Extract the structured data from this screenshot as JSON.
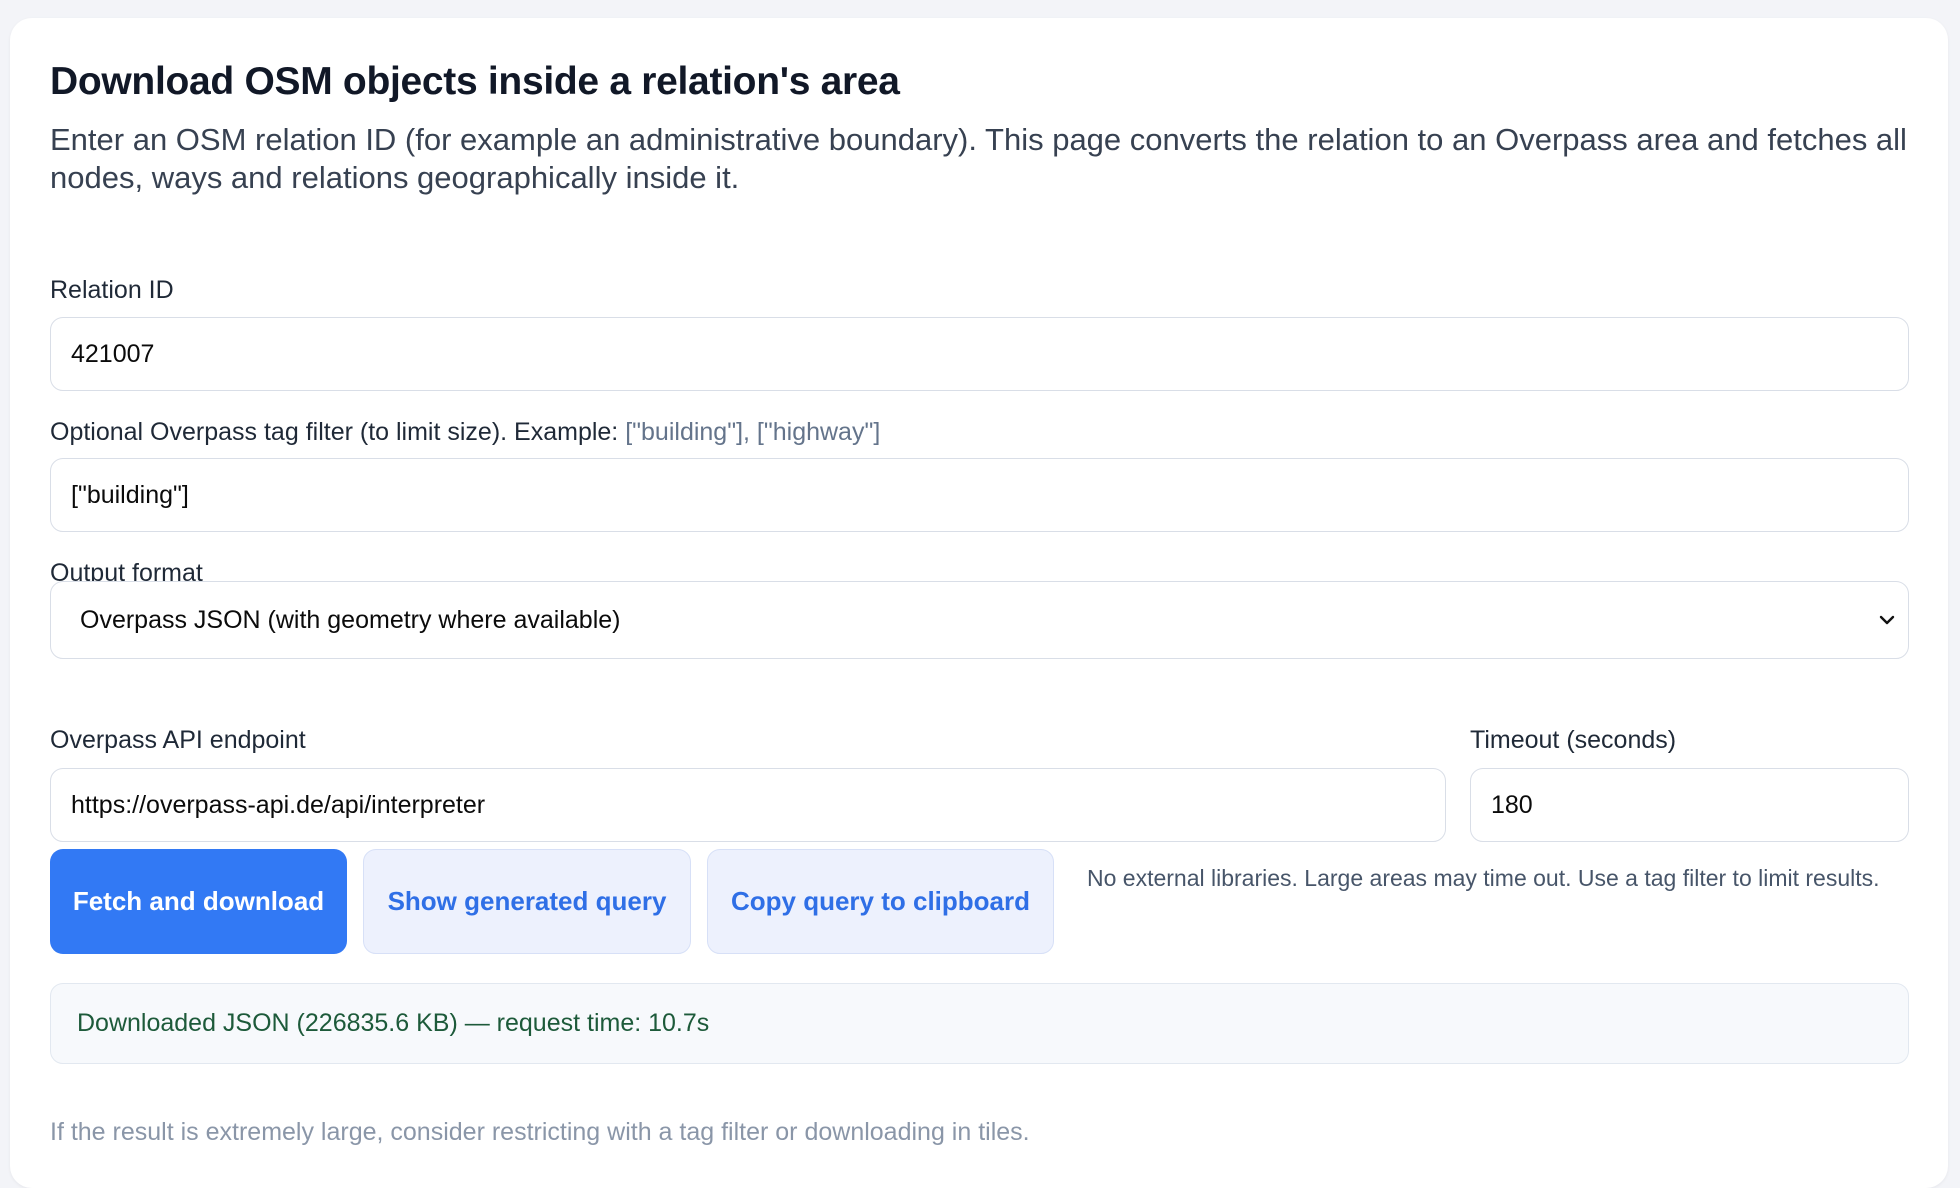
{
  "page": {
    "title": "Download OSM objects inside a relation's area",
    "intro": "Enter an OSM relation ID (for example an administrative boundary). This page converts the relation to an Overpass area and fetches all nodes, ways and relations geographically inside it."
  },
  "form": {
    "relation_id": {
      "label": "Relation ID",
      "value": "421007"
    },
    "tag_filter": {
      "label": "Optional Overpass tag filter (to limit size). Example:",
      "example": "[\"building\"], [\"highway\"]",
      "value": "[\"building\"]"
    },
    "output_format": {
      "label": "Output format",
      "selected": "Overpass JSON (with geometry where available)"
    },
    "endpoint": {
      "label": "Overpass API endpoint",
      "value": "https://overpass-api.de/api/interpreter"
    },
    "timeout": {
      "label": "Timeout (seconds)",
      "value": "180"
    }
  },
  "actions": {
    "fetch_label": "Fetch and download",
    "show_query_label": "Show generated query",
    "copy_query_label": "Copy query to clipboard",
    "note": "No external libraries. Large areas may time out. Use a tag filter to limit results."
  },
  "status": {
    "message": "Downloaded JSON (226835.6 KB) — request time: 10.7s"
  },
  "footnote": "If the result is extremely large, consider restricting with a tag filter or downloading in tiles.",
  "colors": {
    "primary": "#3279f4",
    "secondary_bg": "#edf1fd",
    "secondary_text": "#2f6fe6",
    "status_text": "#1d5a3a",
    "muted": "#8a96a8"
  },
  "icons": {
    "select_chevron": "chevron-down-icon"
  }
}
